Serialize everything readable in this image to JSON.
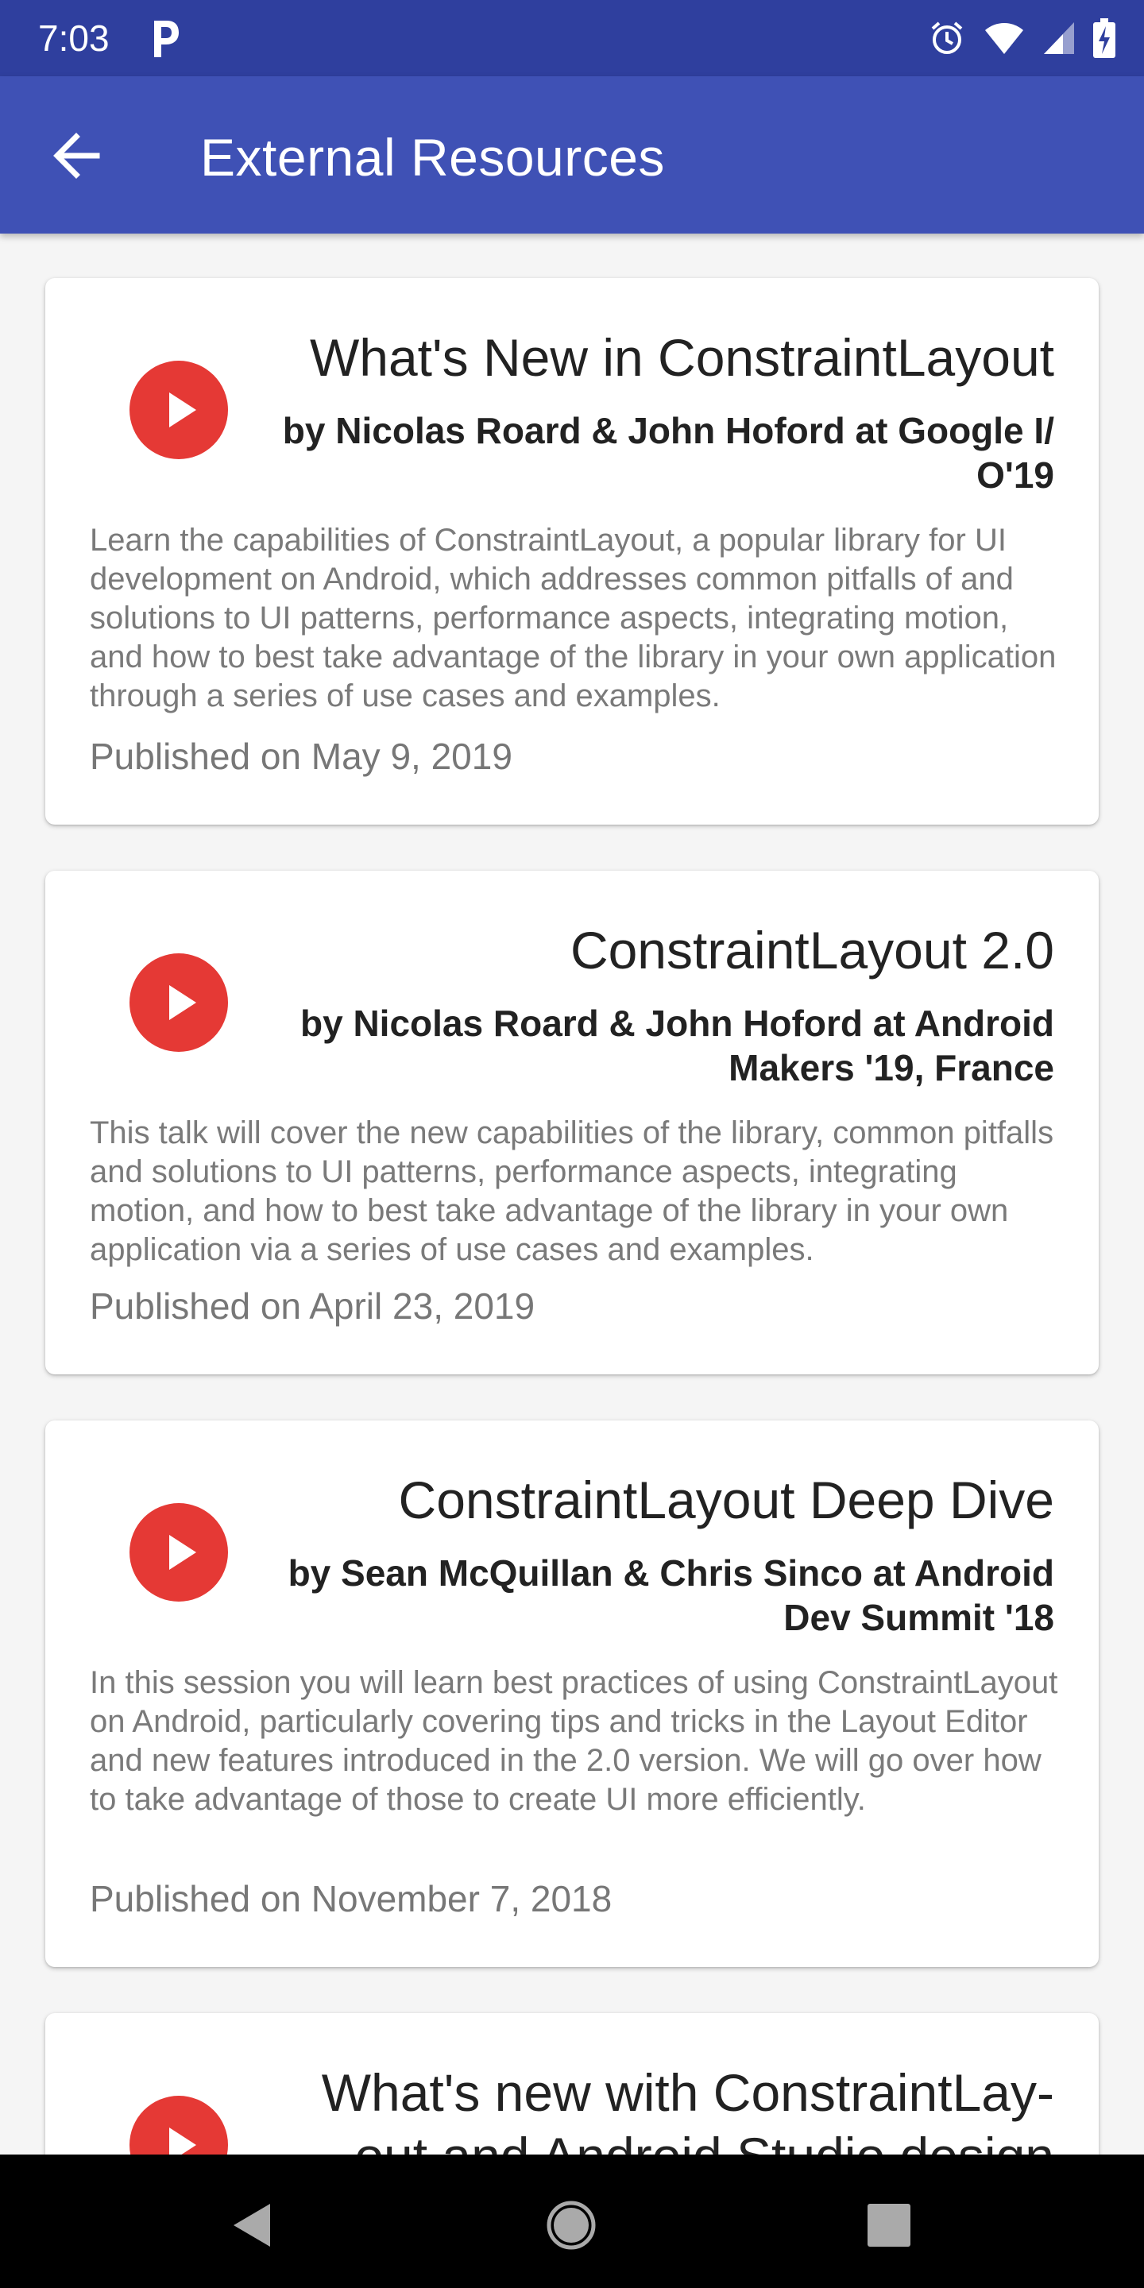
{
  "status_bar": {
    "time": "7:03",
    "icons": [
      "parking-icon",
      "alarm-icon",
      "wifi-icon",
      "signal-icon",
      "battery-icon"
    ]
  },
  "app_bar": {
    "title": "External Resources",
    "back_icon": "arrow-back-icon"
  },
  "colors": {
    "status_bar": "#2f3f9e",
    "app_bar": "#3f51b5",
    "play_button": "#e53935",
    "background": "#f5f5f5"
  },
  "videos": [
    {
      "title": "What's New in ConstraintLayout",
      "subtitle_line1": "by Nicolas Roard & John Hoford at Google I/",
      "subtitle_line2": "O'19",
      "description": "Learn the capabilities of ConstraintLayout, a popular library for UI development on Android, which addresses common pitfalls of and solutions to UI patterns, performance aspects, integrating motion, and how to best take advantage of the library in your own application through a series of use cases and examples.",
      "date": "Published on May 9, 2019"
    },
    {
      "title": "ConstraintLayout 2.0",
      "subtitle_line1": "by Nicolas Roard & John Hoford at Android",
      "subtitle_line2": "Makers '19, France",
      "description": "This talk will cover the new capabilities of the library, common pitfalls and solutions to UI patterns, performance aspects, integrating motion, and how to best take advantage of the library in your own application via a series of use cases and examples.",
      "date": "Published on April 23, 2019"
    },
    {
      "title": "ConstraintLayout Deep Dive",
      "subtitle_line1": "by Sean McQuillan & Chris Sinco at Android",
      "subtitle_line2": "Dev Summit '18",
      "description": "In this session you will learn best practices of using ConstraintLayout on Android, particularly covering tips and tricks in the Layout Editor and new features introduced in the 2.0 version. We will go over how to take advantage of those to create UI more efficiently.",
      "date": "Published on November 7, 2018"
    },
    {
      "title": "What's new with ConstraintLay-",
      "subtitle_line1": "out and Android Studio design"
    }
  ],
  "nav_bar": {
    "buttons": [
      "back-triangle-icon",
      "home-circle-icon",
      "recents-square-icon"
    ]
  }
}
